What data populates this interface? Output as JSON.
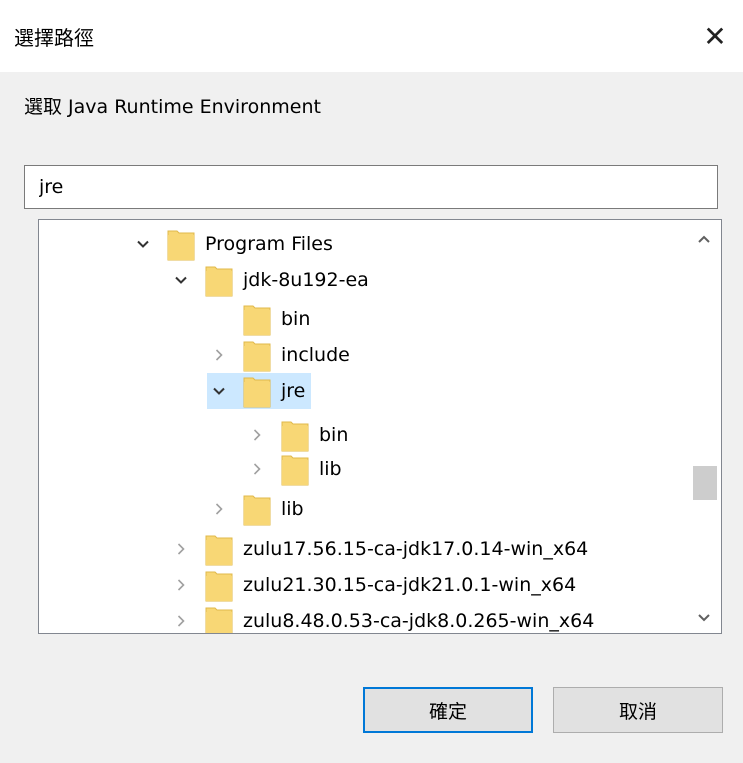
{
  "dialog": {
    "title": "選擇路徑",
    "close_symbol": "✕",
    "prompt": "選取 Java Runtime Environment",
    "path_value": "jre"
  },
  "tree": {
    "items": [
      {
        "label": "Program Files",
        "expander": "expanded"
      },
      {
        "label": "jdk-8u192-ea",
        "expander": "expanded"
      },
      {
        "label": "bin",
        "expander": "none"
      },
      {
        "label": "include",
        "expander": "collapsed"
      },
      {
        "label": "jre",
        "expander": "expanded",
        "selected": true
      },
      {
        "label": "bin",
        "expander": "collapsed"
      },
      {
        "label": "lib",
        "expander": "collapsed"
      },
      {
        "label": "lib",
        "expander": "collapsed"
      },
      {
        "label": "zulu17.56.15-ca-jdk17.0.14-win_x64",
        "expander": "collapsed"
      },
      {
        "label": "zulu21.30.15-ca-jdk21.0.1-win_x64",
        "expander": "collapsed"
      },
      {
        "label": "zulu8.48.0.53-ca-jdk8.0.265-win_x64",
        "expander": "collapsed"
      }
    ]
  },
  "buttons": {
    "ok": "確定",
    "cancel": "取消"
  },
  "colors": {
    "accent": "#0078d7",
    "selection": "#cce8ff",
    "folder": "#f8d775"
  }
}
